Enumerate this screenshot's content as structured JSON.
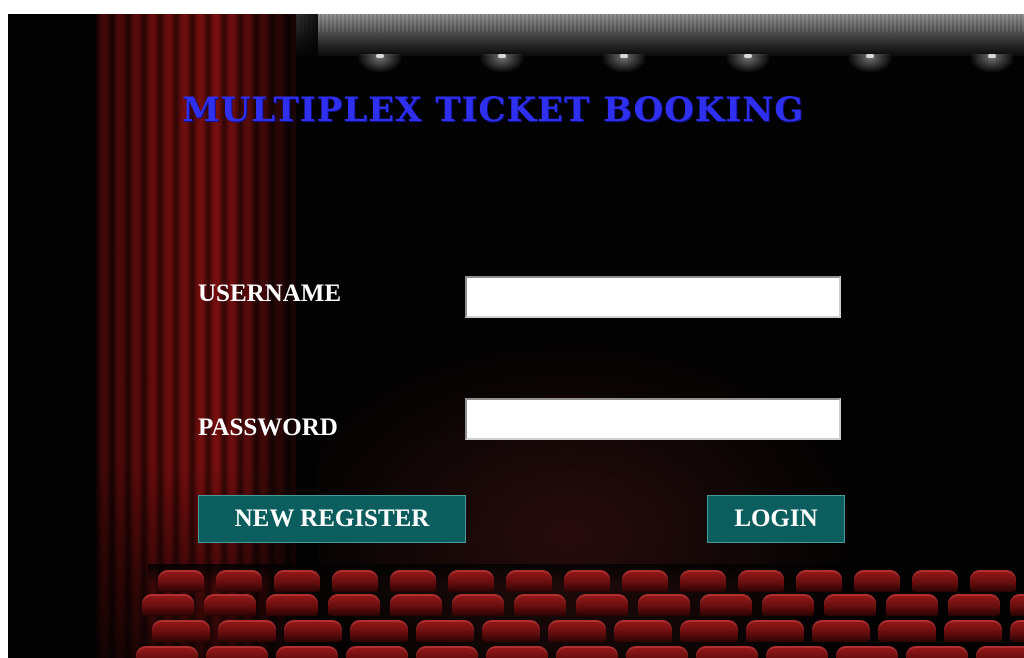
{
  "app": {
    "title": "MULTIPLEX TICKET BOOKING"
  },
  "form": {
    "username_label": "USERNAME",
    "username_value": "",
    "password_label": "PASSWORD",
    "password_value": ""
  },
  "buttons": {
    "new_register": "NEW REGISTER",
    "login": "LOGIN"
  },
  "colors": {
    "title": "#2f2ff0",
    "button_bg": "#0c5e5e",
    "background": "#020202",
    "curtain": "#6e0d0d"
  }
}
